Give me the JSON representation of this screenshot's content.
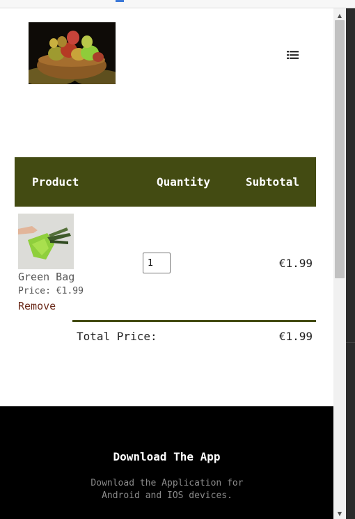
{
  "header": {
    "logo_alt": "Basket of fruit",
    "menu_icon": "list-icon"
  },
  "cart": {
    "columns": {
      "product": "Product",
      "quantity": "Quantity",
      "subtotal": "Subtotal"
    },
    "items": [
      {
        "name": "Green Bag",
        "price_text": "Price: €1.99",
        "remove_label": "Remove",
        "quantity": "1",
        "subtotal": "€1.99"
      }
    ],
    "total_label": "Total Price:",
    "total_value": "€1.99"
  },
  "footer": {
    "title": "Download The App",
    "text": "Download the Application for Android and IOS devices."
  },
  "colors": {
    "header_bg": "#434b12",
    "remove_link": "#6b2a1a",
    "footer_bg": "#000000"
  }
}
